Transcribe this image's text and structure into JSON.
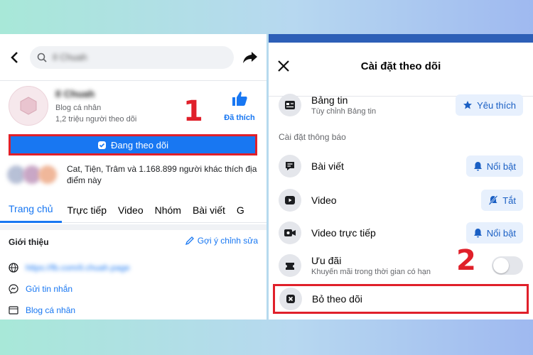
{
  "left": {
    "search": {
      "placeholder": "Il Chuah"
    },
    "profile": {
      "name": "Il Chuah",
      "category": "Blog cá nhân",
      "followers": "1,2 triệu người theo dõi",
      "like_label": "Đã thích"
    },
    "following_button": "Đang theo dõi",
    "friends_liked": "Cat, Tiện, Trâm và 1.168.899 người khác thích địa điểm này",
    "tabs": [
      "Trang chủ",
      "Trực tiếp",
      "Video",
      "Nhóm",
      "Bài viết",
      "G"
    ],
    "intro": {
      "title": "Giới thiệu",
      "suggest_edit": "Gợi ý chỉnh sửa",
      "website": "https://fb.com/il.chuah.page",
      "message": "Gửi tin nhắn",
      "category": "Blog cá nhân"
    }
  },
  "right": {
    "title": "Cài đặt theo dõi",
    "news_feed": {
      "title": "Bảng tin",
      "subtitle": "Tùy chỉnh Bảng tin",
      "button": "Yêu thích"
    },
    "notification_section": "Cài đặt thông báo",
    "posts": {
      "title": "Bài viết",
      "button": "Nổi bật"
    },
    "video": {
      "title": "Video",
      "button": "Tắt"
    },
    "live_video": {
      "title": "Video trực tiếp",
      "button": "Nổi bật"
    },
    "offers": {
      "title": "Ưu đãi",
      "subtitle": "Khuyến mãi trong thời gian có hạn",
      "toggle_on": false
    },
    "unfollow": "Bỏ theo dõi"
  },
  "annotations": {
    "step1": "1",
    "step2": "2"
  },
  "colors": {
    "accent": "#1877f2",
    "highlight": "#e0202a"
  }
}
